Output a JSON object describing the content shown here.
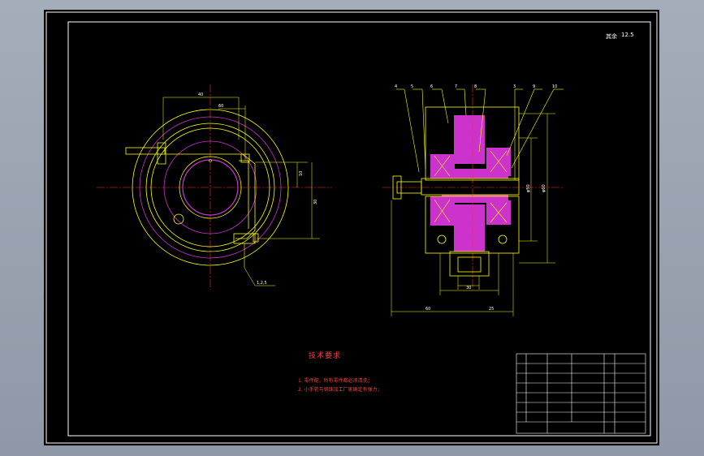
{
  "colors": {
    "background": "#000000",
    "frame": "#ffffff",
    "outline": "#ffff00",
    "hatch": "#cc33cc",
    "center_line": "#ff2a2a",
    "text": "#ff3b3b"
  },
  "drawing": {
    "tech_title": "技术要求",
    "notes": [
      "1. 零件配，所有零件都必须清洗；",
      "2. 小手轮与钢珠加工厂家确定有弹力；"
    ],
    "roughness_label": "其余",
    "roughness_value": "12.5",
    "leader_label": "1,2,5",
    "balloons": [
      "4",
      "5",
      "6",
      "7",
      "8",
      "3",
      "9",
      "10"
    ],
    "dims_left": [
      "40",
      "60",
      "10",
      "30"
    ],
    "dims_right": [
      "60",
      "25",
      "30",
      "φ60",
      "φ50"
    ]
  }
}
